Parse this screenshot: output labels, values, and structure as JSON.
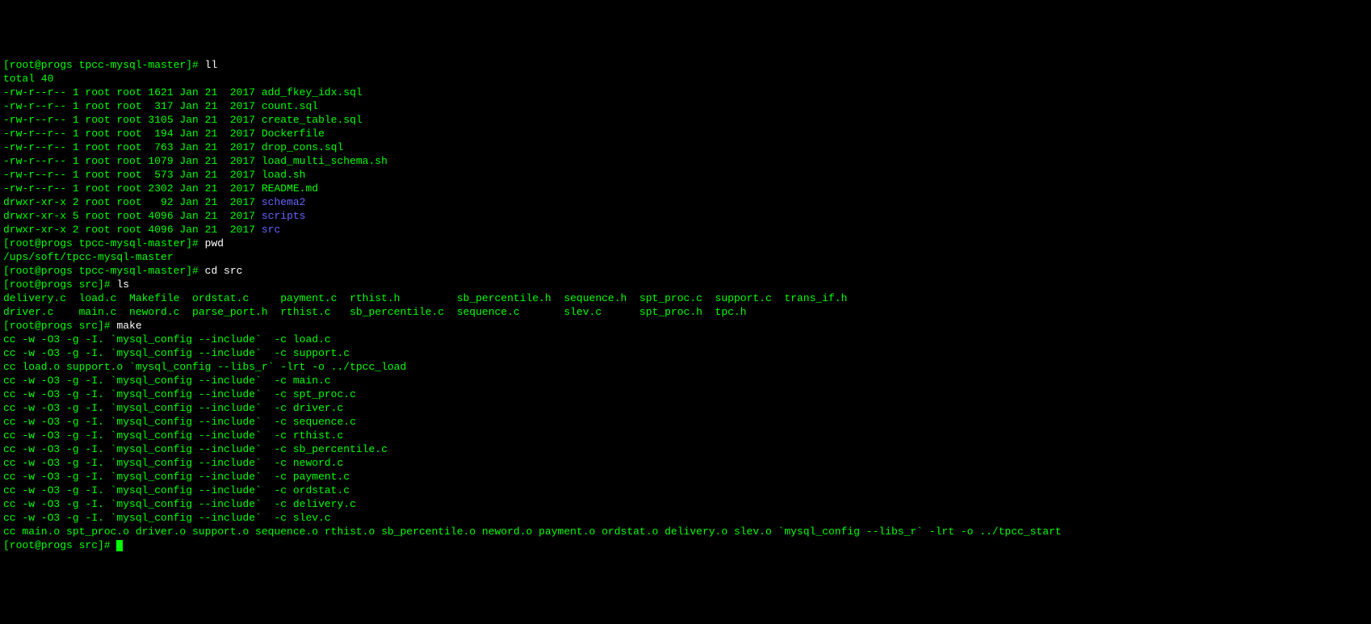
{
  "prompts": {
    "p1": "[root@progs tpcc-mysql-master]#",
    "p2": "[root@progs src]#"
  },
  "cmds": {
    "ll": "ll",
    "pwd": "pwd",
    "cdsrc": "cd src",
    "ls": "ls",
    "make": "make"
  },
  "total": "total 40",
  "ll_rows": [
    {
      "perm": "-rw-r--r-- 1 root root 1621 Jan 21  2017 ",
      "name": "add_fkey_idx.sql",
      "dir": false
    },
    {
      "perm": "-rw-r--r-- 1 root root  317 Jan 21  2017 ",
      "name": "count.sql",
      "dir": false
    },
    {
      "perm": "-rw-r--r-- 1 root root 3105 Jan 21  2017 ",
      "name": "create_table.sql",
      "dir": false
    },
    {
      "perm": "-rw-r--r-- 1 root root  194 Jan 21  2017 ",
      "name": "Dockerfile",
      "dir": false
    },
    {
      "perm": "-rw-r--r-- 1 root root  763 Jan 21  2017 ",
      "name": "drop_cons.sql",
      "dir": false
    },
    {
      "perm": "-rw-r--r-- 1 root root 1079 Jan 21  2017 ",
      "name": "load_multi_schema.sh",
      "dir": false
    },
    {
      "perm": "-rw-r--r-- 1 root root  573 Jan 21  2017 ",
      "name": "load.sh",
      "dir": false
    },
    {
      "perm": "-rw-r--r-- 1 root root 2302 Jan 21  2017 ",
      "name": "README.md",
      "dir": false
    },
    {
      "perm": "drwxr-xr-x 2 root root   92 Jan 21  2017 ",
      "name": "schema2",
      "dir": true
    },
    {
      "perm": "drwxr-xr-x 5 root root 4096 Jan 21  2017 ",
      "name": "scripts",
      "dir": true
    },
    {
      "perm": "drwxr-xr-x 2 root root 4096 Jan 21  2017 ",
      "name": "src",
      "dir": true
    }
  ],
  "pwd_out": "/ups/soft/tpcc-mysql-master",
  "ls_row1": "delivery.c  load.c  Makefile  ordstat.c     payment.c  rthist.h         sb_percentile.h  sequence.h  spt_proc.c  support.c  trans_if.h",
  "ls_row2": "driver.c    main.c  neword.c  parse_port.h  rthist.c   sb_percentile.c  sequence.c       slev.c      spt_proc.h  tpc.h",
  "make_lines": [
    "cc -w -O3 -g -I. `mysql_config --include`  -c load.c",
    "cc -w -O3 -g -I. `mysql_config --include`  -c support.c",
    "cc load.o support.o `mysql_config --libs_r` -lrt -o ../tpcc_load",
    "cc -w -O3 -g -I. `mysql_config --include`  -c main.c",
    "cc -w -O3 -g -I. `mysql_config --include`  -c spt_proc.c",
    "cc -w -O3 -g -I. `mysql_config --include`  -c driver.c",
    "cc -w -O3 -g -I. `mysql_config --include`  -c sequence.c",
    "cc -w -O3 -g -I. `mysql_config --include`  -c rthist.c",
    "cc -w -O3 -g -I. `mysql_config --include`  -c sb_percentile.c",
    "cc -w -O3 -g -I. `mysql_config --include`  -c neword.c",
    "cc -w -O3 -g -I. `mysql_config --include`  -c payment.c",
    "cc -w -O3 -g -I. `mysql_config --include`  -c ordstat.c",
    "cc -w -O3 -g -I. `mysql_config --include`  -c delivery.c",
    "cc -w -O3 -g -I. `mysql_config --include`  -c slev.c",
    "cc main.o spt_proc.o driver.o support.o sequence.o rthist.o sb_percentile.o neword.o payment.o ordstat.o delivery.o slev.o `mysql_config --libs_r` -lrt -o ../tpcc_start"
  ]
}
